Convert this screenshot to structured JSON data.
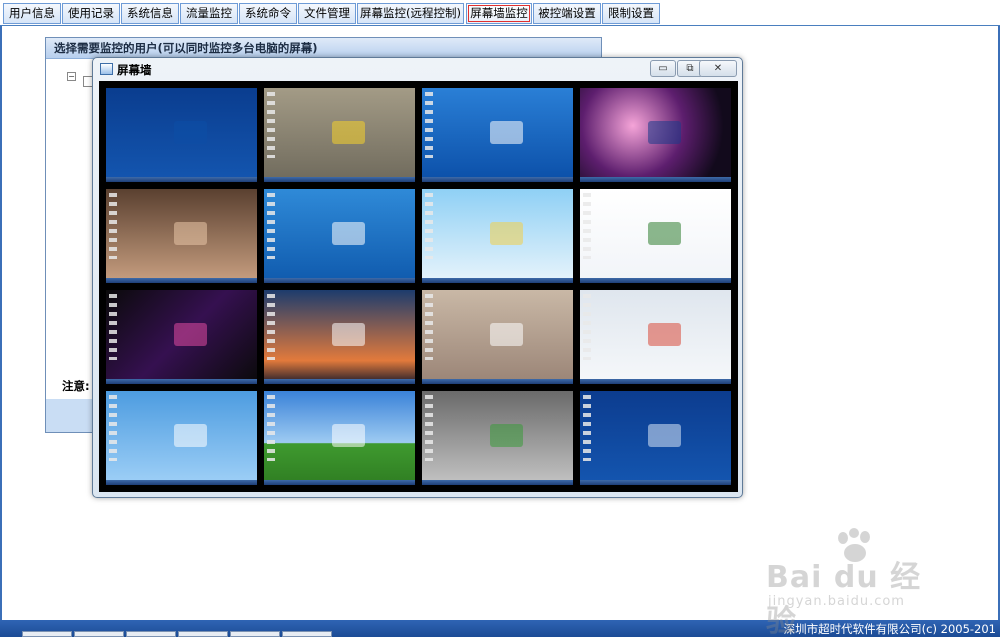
{
  "tabs": [
    {
      "label": "用户信息"
    },
    {
      "label": "使用记录"
    },
    {
      "label": "系统信息"
    },
    {
      "label": "流量监控"
    },
    {
      "label": "系统命令"
    },
    {
      "label": "文件管理"
    },
    {
      "label": "屏幕监控(远程控制)"
    },
    {
      "label": "屏幕墙监控",
      "active": true
    },
    {
      "label": "被控端设置"
    },
    {
      "label": "限制设置"
    }
  ],
  "back_dialog": {
    "title": "选择需要监控的用户(可以同时监控多台电脑的屏幕)",
    "tree_toggle": "−",
    "notice_label": "注意:"
  },
  "window": {
    "title": "屏幕墙",
    "minimize_glyph": "▭",
    "restore_glyph": "⧉",
    "close_glyph": "✕"
  },
  "screens": [
    {
      "bg": "linear-gradient(#0a3d8f,#1456b0)",
      "icons": false,
      "tint": "#0d4ea6"
    },
    {
      "bg": "linear-gradient(#a39b86,#6f6a5c)",
      "icons": true,
      "tint": "#f5d22c"
    },
    {
      "bg": "linear-gradient(#2a7fd6,#0b4fa8)",
      "icons": true,
      "tint": "#ffffff"
    },
    {
      "bg": "radial-gradient(circle at 35% 40%,#f5a4d8,#5d1e6e 45%,#120a1c 80%)",
      "icons": false,
      "tint": "#1a3a8a"
    },
    {
      "bg": "linear-gradient(#5a4030,#c9a081)",
      "icons": true,
      "tint": "#e9c6a8"
    },
    {
      "bg": "linear-gradient(#2f8ad8,#0f5aad)",
      "icons": true,
      "tint": "#ffffff"
    },
    {
      "bg": "linear-gradient(#8fd0f5,#e8f4fb)",
      "icons": true,
      "tint": "#f3d04a"
    },
    {
      "bg": "linear-gradient(#ffffff,#f1f4f8)",
      "icons": true,
      "tint": "#2f7d2f"
    },
    {
      "bg": "linear-gradient(135deg,#0a0a0a,#351050 50%,#0a0a0a)",
      "icons": true,
      "tint": "#e04aa0"
    },
    {
      "bg": "linear-gradient(#1d3c6d,#e27a3c 75%,#1b1a2a)",
      "icons": true,
      "tint": "#ffffff"
    },
    {
      "bg": "linear-gradient(#c9b8a6,#9a8476)",
      "icons": true,
      "tint": "#ffffff"
    },
    {
      "bg": "linear-gradient(#dfe6ee,#f6f8fa)",
      "icons": true,
      "tint": "#d94a3a"
    },
    {
      "bg": "linear-gradient(#4d9ce0,#9fd0f7)",
      "icons": true,
      "tint": "#ffffff"
    },
    {
      "bg": "linear-gradient(#3a82d8 0,#9ecbf2 55%,#3f9a2f 56%,#2f7d22)",
      "icons": true,
      "tint": "#ffffff"
    },
    {
      "bg": "linear-gradient(#6a6a6a,#c4c4c4)",
      "icons": true,
      "tint": "#3a9a3a"
    },
    {
      "bg": "linear-gradient(#0c3c8f,#1456b0)",
      "icons": true,
      "tint": "#d9e6f5"
    }
  ],
  "status": {
    "copyright": "深圳市超时代软件有限公司(c) 2005-201"
  },
  "watermark": {
    "brand": "Bai du 经验",
    "site": "jingyan.baidu.com"
  },
  "colors": {
    "accent": "#3b6fb8",
    "active_tab_outline": "#e03030",
    "status_bar": "#1b4b95"
  }
}
